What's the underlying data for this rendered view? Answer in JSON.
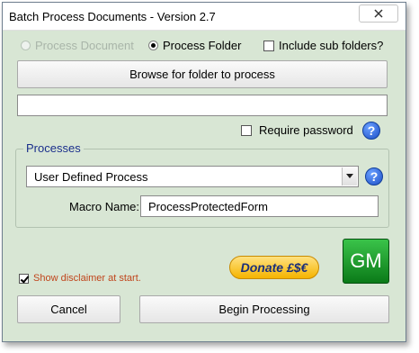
{
  "window": {
    "title": "Batch Process Documents - Version 2.7"
  },
  "source_options": {
    "process_document": {
      "label": "Process Document",
      "selected": false,
      "enabled": false
    },
    "process_folder": {
      "label": "Process Folder",
      "selected": true,
      "enabled": true
    },
    "include_subfolders": {
      "label": "Include sub folders?",
      "checked": false
    }
  },
  "browse_button": {
    "label": "Browse for folder to process"
  },
  "folder_path": {
    "value": ""
  },
  "require_password": {
    "label": "Require password",
    "checked": false
  },
  "processes": {
    "group_label": "Processes",
    "selected_process": "User Defined Process",
    "macro_label": "Macro Name:",
    "macro_value": "ProcessProtectedForm"
  },
  "donate": {
    "label": "Donate £$€"
  },
  "logo": {
    "text": "GM"
  },
  "disclaimer": {
    "label": "Show disclaimer at start.",
    "checked": true,
    "color": "#c0451c"
  },
  "buttons": {
    "cancel": "Cancel",
    "begin": "Begin Processing"
  },
  "icons": {
    "help": "help-question-icon",
    "close": "close-icon",
    "dropdown": "chevron-down-icon"
  }
}
